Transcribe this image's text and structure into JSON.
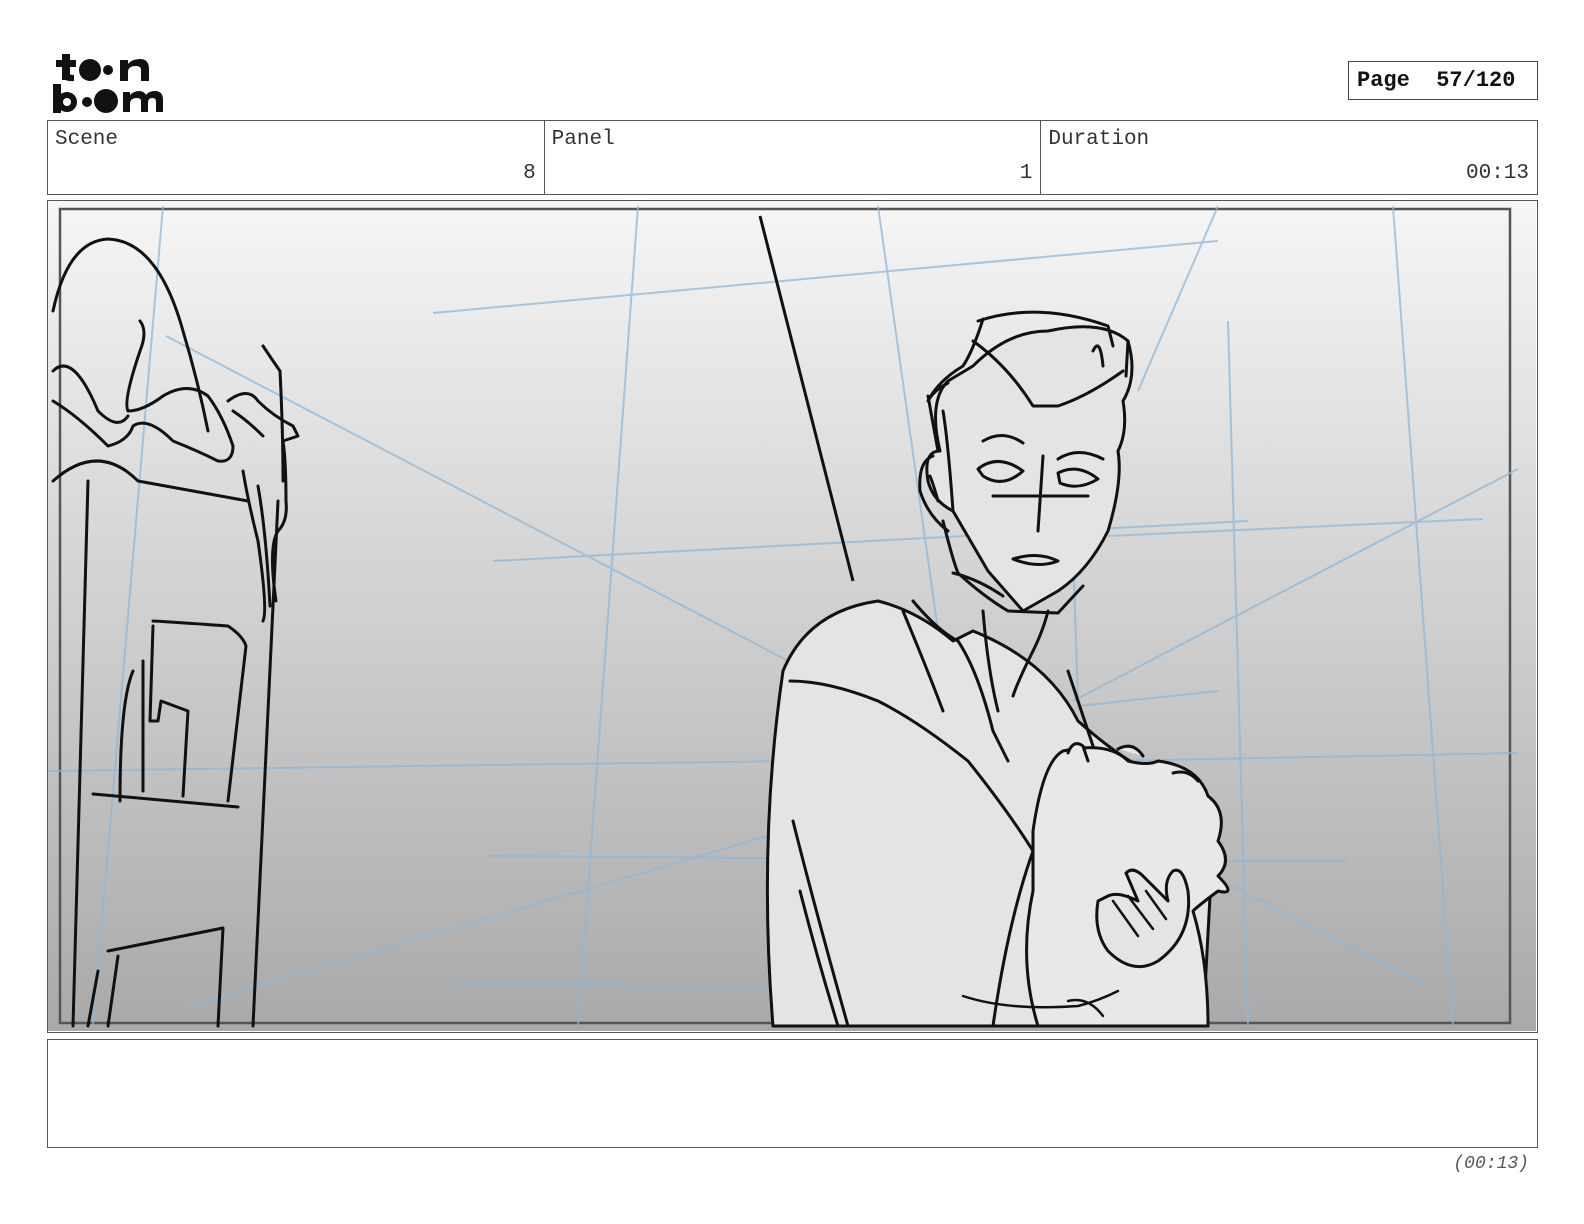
{
  "brand": {
    "logo_text": "toon boom",
    "logo_name": "toon-boom-logo"
  },
  "page": {
    "label": "Page",
    "current": "57/120",
    "display": "Page  57/120"
  },
  "info": {
    "scene": {
      "label": "Scene",
      "value": "8"
    },
    "panel": {
      "label": "Panel",
      "value": "1"
    },
    "duration": {
      "label": "Duration",
      "value": "00:13"
    }
  },
  "notes": {
    "text": ""
  },
  "footer": {
    "total_duration": "(00:13)"
  }
}
